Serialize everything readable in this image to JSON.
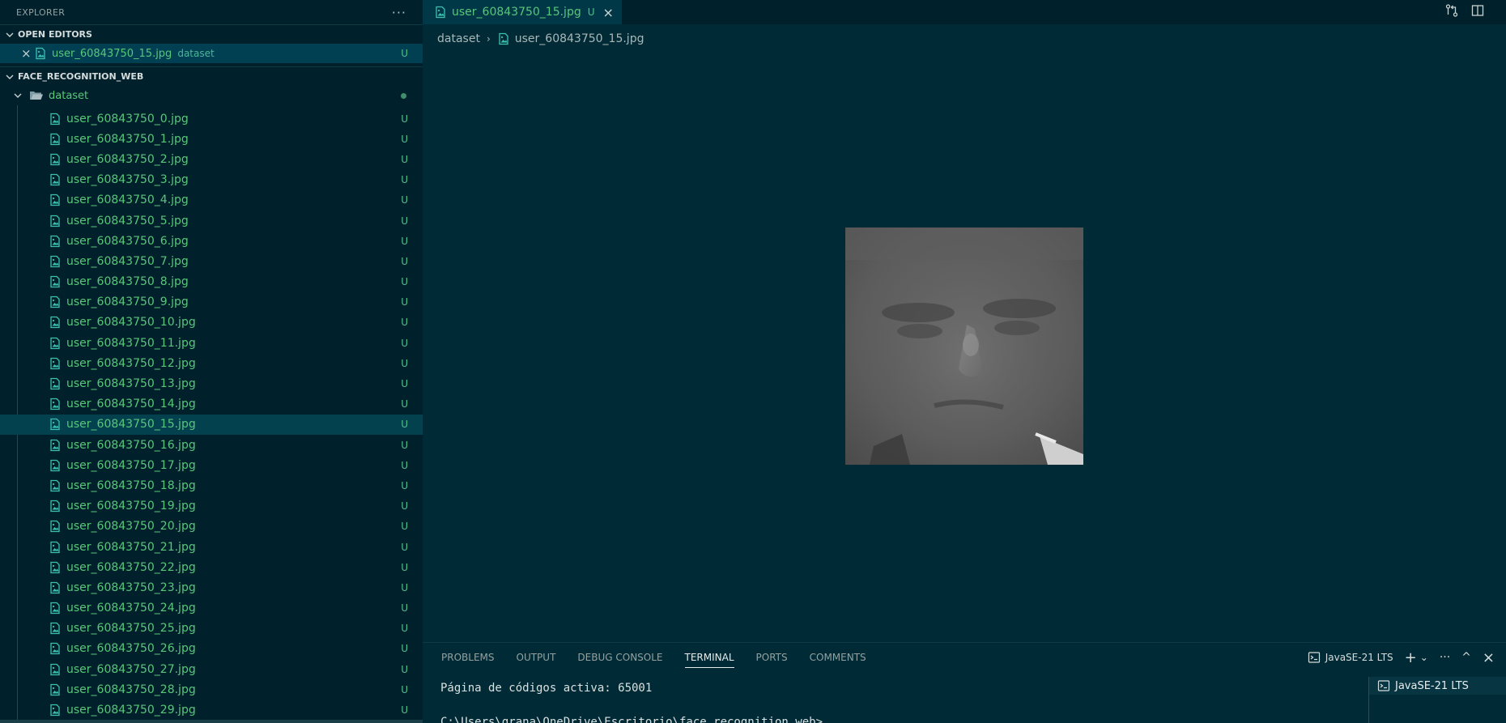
{
  "sidebar": {
    "title": "EXPLORER",
    "more_label": "···",
    "open_editors": {
      "header": "OPEN EDITORS",
      "items": [
        {
          "close": "×",
          "label": "user_60843750_15.jpg",
          "description": "dataset",
          "status": "U"
        }
      ]
    },
    "workspace": {
      "header": "FACE_RECOGNITION_WEB",
      "folder": "dataset",
      "files": [
        {
          "label": "user_60843750_0.jpg",
          "status": "U"
        },
        {
          "label": "user_60843750_1.jpg",
          "status": "U"
        },
        {
          "label": "user_60843750_2.jpg",
          "status": "U"
        },
        {
          "label": "user_60843750_3.jpg",
          "status": "U"
        },
        {
          "label": "user_60843750_4.jpg",
          "status": "U"
        },
        {
          "label": "user_60843750_5.jpg",
          "status": "U"
        },
        {
          "label": "user_60843750_6.jpg",
          "status": "U"
        },
        {
          "label": "user_60843750_7.jpg",
          "status": "U"
        },
        {
          "label": "user_60843750_8.jpg",
          "status": "U"
        },
        {
          "label": "user_60843750_9.jpg",
          "status": "U"
        },
        {
          "label": "user_60843750_10.jpg",
          "status": "U"
        },
        {
          "label": "user_60843750_11.jpg",
          "status": "U"
        },
        {
          "label": "user_60843750_12.jpg",
          "status": "U"
        },
        {
          "label": "user_60843750_13.jpg",
          "status": "U"
        },
        {
          "label": "user_60843750_14.jpg",
          "status": "U"
        },
        {
          "label": "user_60843750_15.jpg",
          "status": "U",
          "selected": true
        },
        {
          "label": "user_60843750_16.jpg",
          "status": "U"
        },
        {
          "label": "user_60843750_17.jpg",
          "status": "U"
        },
        {
          "label": "user_60843750_18.jpg",
          "status": "U"
        },
        {
          "label": "user_60843750_19.jpg",
          "status": "U"
        },
        {
          "label": "user_60843750_20.jpg",
          "status": "U"
        },
        {
          "label": "user_60843750_21.jpg",
          "status": "U"
        },
        {
          "label": "user_60843750_22.jpg",
          "status": "U"
        },
        {
          "label": "user_60843750_23.jpg",
          "status": "U"
        },
        {
          "label": "user_60843750_24.jpg",
          "status": "U"
        },
        {
          "label": "user_60843750_25.jpg",
          "status": "U"
        },
        {
          "label": "user_60843750_26.jpg",
          "status": "U"
        },
        {
          "label": "user_60843750_27.jpg",
          "status": "U"
        },
        {
          "label": "user_60843750_28.jpg",
          "status": "U"
        },
        {
          "label": "user_60843750_29.jpg",
          "status": "U"
        }
      ]
    }
  },
  "editor": {
    "active_tab": {
      "label": "user_60843750_15.jpg",
      "status": "U",
      "close": "×"
    },
    "breadcrumb": {
      "folder": "dataset",
      "separator": "›",
      "file": "user_60843750_15.jpg"
    }
  },
  "panel": {
    "tabs": [
      "PROBLEMS",
      "OUTPUT",
      "DEBUG CONSOLE",
      "TERMINAL",
      "PORTS",
      "COMMENTS"
    ],
    "active_tab": "TERMINAL",
    "terminal_name": "JavaSE-21 LTS",
    "add": "+",
    "dropdown": "⌄",
    "more": "···",
    "maximize": "^",
    "close": "×",
    "terminal_lines": [
      "Página de códigos activa: 65001",
      "C:\\Users\\grana\\OneDrive\\Escritorio\\face_recognition_web>"
    ],
    "terminal_list": [
      "JavaSE-21 LTS"
    ]
  },
  "colors": {
    "editor_bg": "#002b36",
    "sidebar_bg": "#00212b",
    "untracked_green": "#58c77a",
    "selection": "#03414f"
  }
}
